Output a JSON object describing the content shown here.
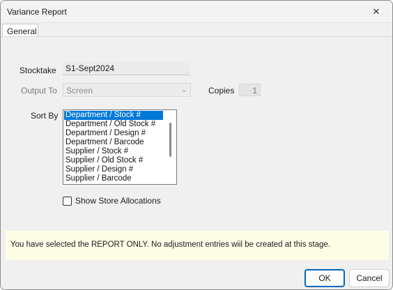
{
  "window": {
    "title": "Variance Report",
    "close_glyph": "✕"
  },
  "tabs": [
    {
      "label": "General"
    }
  ],
  "form": {
    "stocktake_label": "Stocktake",
    "stocktake_value": "S1-Sept2024",
    "output_label": "Output To",
    "output_value": "Screen",
    "copies_label": "Copies",
    "copies_value": "1",
    "sortby_label": "Sort By",
    "sort_options": [
      "Department / Stock #",
      "Department / Old Stock #",
      "Department / Design #",
      "Department / Barcode",
      "Supplier / Stock #",
      "Supplier / Old Stock #",
      "Supplier / Design #",
      "Supplier / Barcode"
    ],
    "selected_sort_index": 0,
    "show_allocations_label": "Show Store Allocations",
    "show_allocations_checked": false
  },
  "notice": {
    "text": "You have selected the REPORT ONLY.  No adjustment entries wiil be created at this stage."
  },
  "buttons": {
    "ok": "OK",
    "cancel": "Cancel"
  },
  "colors": {
    "selection": "#0078d7",
    "notice_bg": "#fdfde6",
    "primary_border": "#0067c0"
  },
  "icons": {
    "close": "close-icon",
    "dropdown": "chevron-down-icon"
  }
}
